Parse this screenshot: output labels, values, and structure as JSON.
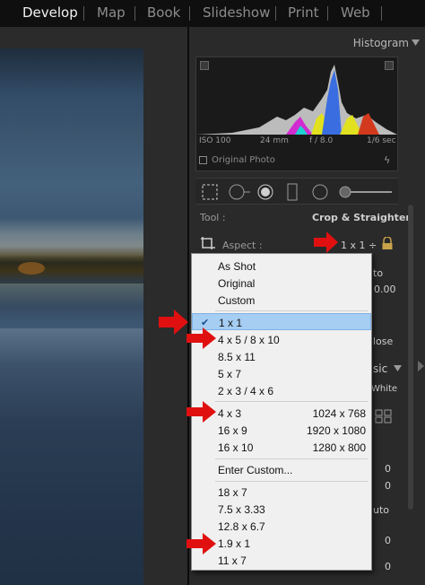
{
  "topbar": {
    "modules": [
      "Develop",
      "Map",
      "Book",
      "Slideshow",
      "Print",
      "Web"
    ],
    "active": "Develop"
  },
  "histogram": {
    "title": "Histogram",
    "iso": "ISO 100",
    "focal": "24 mm",
    "aperture": "f / 8.0",
    "shutter": "1/6 sec",
    "original_photo": "Original Photo"
  },
  "crop": {
    "tool_label": "Tool :",
    "tool_value": "Crop & Straighten",
    "aspect_label": "Aspect :",
    "aspect_value": "1 x 1 ÷"
  },
  "panel_fragments": {
    "auto_partial": "to",
    "angle_value": "0.00",
    "close_partial": "lose",
    "basic_partial": "sic",
    "white_partial": "White",
    "zero_a": "0",
    "zero_b": "0",
    "auto_partial2": "uto",
    "zero_c": "0",
    "zero_d": "0"
  },
  "dropdown": {
    "group1": [
      "As Shot",
      "Original",
      "Custom"
    ],
    "group2": [
      {
        "label": "1 x 1",
        "selected": true
      },
      {
        "label": "4 x 5  /  8 x 10",
        "selected": false
      },
      {
        "label": "8.5 x 11",
        "selected": false
      },
      {
        "label": "5 x 7",
        "selected": false
      },
      {
        "label": "2 x 3  /  4 x 6",
        "selected": false
      }
    ],
    "group3": [
      {
        "label": "4 x 3",
        "size": "1024 x 768"
      },
      {
        "label": "16 x 9",
        "size": "1920 x 1080"
      },
      {
        "label": "16 x 10",
        "size": "1280 x 800"
      }
    ],
    "group4": [
      "Enter Custom..."
    ],
    "group5": [
      "18 x 7",
      "7.5 x 3.33",
      "12.8 x 6.7",
      "1.9 x 1",
      "11 x 7"
    ]
  },
  "colors": {
    "selected_row": "#a6cdf2",
    "annotation_arrow": "#e01010",
    "panel_bg": "#2a2a2a"
  }
}
